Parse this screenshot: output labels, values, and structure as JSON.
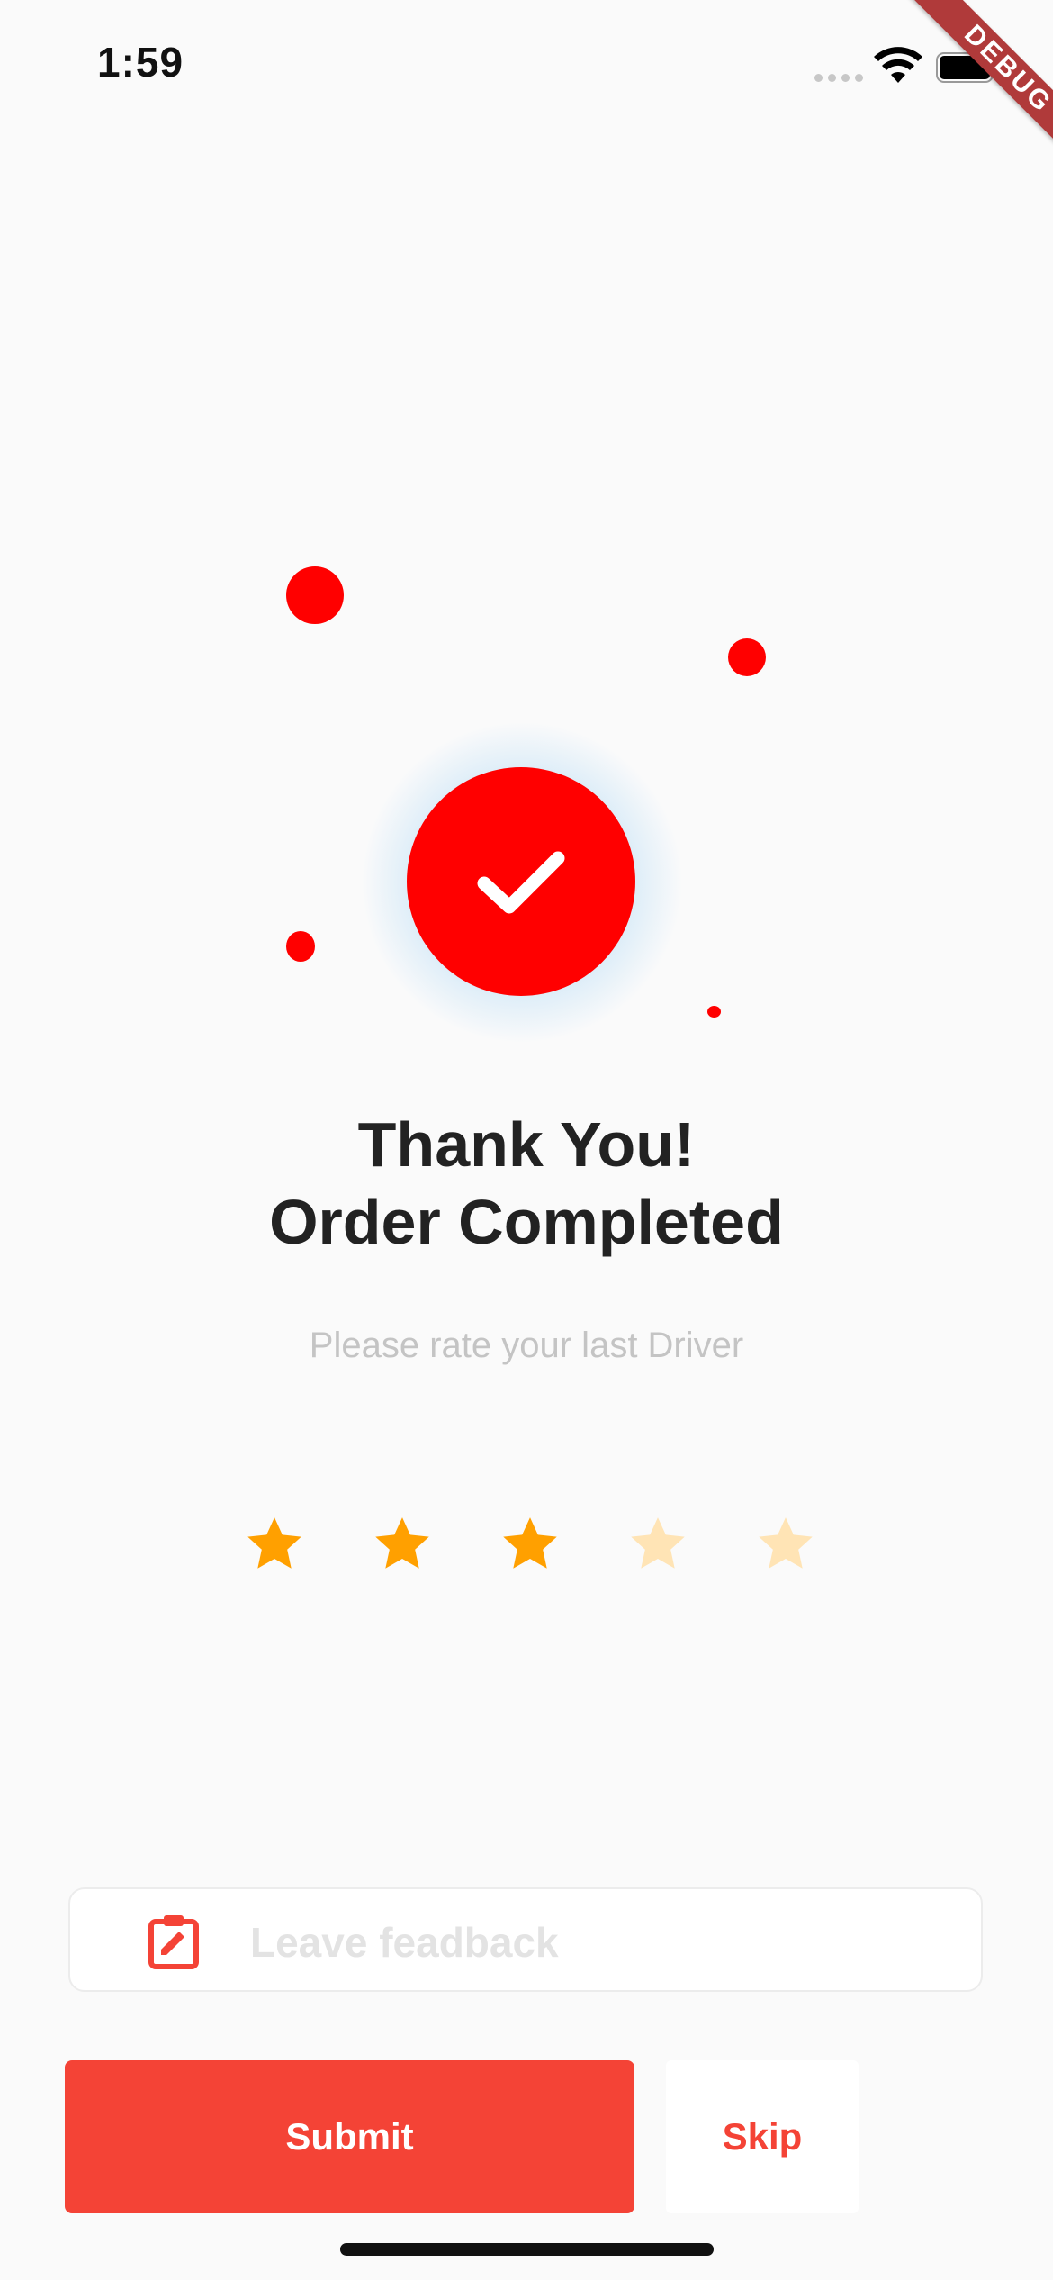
{
  "status_bar": {
    "time": "1:59"
  },
  "debug_banner": "DEBUG",
  "confirmation": {
    "title_line1": "Thank You!",
    "title_line2": "Order Completed",
    "subtitle": "Please rate your last Driver"
  },
  "rating": {
    "value": 3,
    "max": 5,
    "filled_color": "#FFA000",
    "empty_color": "#FFE4B5"
  },
  "feedback": {
    "placeholder": "Leave feadback",
    "icon": "clipboard-edit-icon"
  },
  "actions": {
    "submit_label": "Submit",
    "skip_label": "Skip"
  },
  "colors": {
    "accent": "#F44336",
    "check_circle": "#FF0000",
    "background": "#FAFAFA"
  }
}
